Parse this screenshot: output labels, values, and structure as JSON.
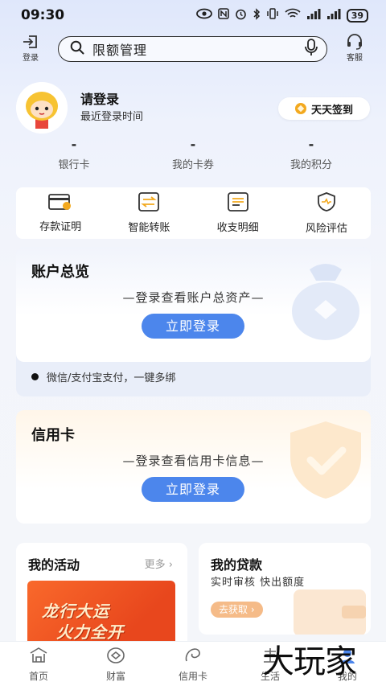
{
  "status_bar": {
    "time": "09:30",
    "battery": "39"
  },
  "header": {
    "login_label": "登录",
    "search_placeholder": "限额管理",
    "service_label": "客服"
  },
  "profile": {
    "title": "请登录",
    "subtitle": "最近登录时间",
    "signin_label": "天天签到"
  },
  "stats": [
    {
      "value": "-",
      "label": "银行卡"
    },
    {
      "value": "-",
      "label": "我的卡券"
    },
    {
      "value": "-",
      "label": "我的积分"
    }
  ],
  "quick_actions": [
    {
      "label": "存款证明",
      "icon": "deposit-card-icon"
    },
    {
      "label": "智能转账",
      "icon": "transfer-icon"
    },
    {
      "label": "收支明细",
      "icon": "statement-icon"
    },
    {
      "label": "风险评估",
      "icon": "risk-shield-icon"
    }
  ],
  "account_overview": {
    "title": "账户总览",
    "message": "—登录查看账户总资产—",
    "button": "立即登录",
    "pay_text": "微信/支付宝支付，一键多绑"
  },
  "credit_card": {
    "title": "信用卡",
    "message": "—登录查看信用卡信息—",
    "button": "立即登录"
  },
  "activity": {
    "title": "我的活动",
    "more": "更多 ›",
    "banner_line1": "龙行大运",
    "banner_line2": "火力全开"
  },
  "loan": {
    "title": "我的贷款",
    "subtitle": "实时审核 快出额度",
    "button": "去获取 ›"
  },
  "nav": [
    {
      "label": "首页",
      "icon": "home-icon"
    },
    {
      "label": "财富",
      "icon": "wealth-icon"
    },
    {
      "label": "信用卡",
      "icon": "credit-card-icon"
    },
    {
      "label": "生活",
      "icon": "life-icon"
    },
    {
      "label": "我的",
      "icon": "me-icon"
    }
  ],
  "watermark": "大玩家",
  "colors": {
    "primary": "#4c86ec",
    "accent_gold": "#f3a91f",
    "banner_orange": "#f9692b"
  }
}
